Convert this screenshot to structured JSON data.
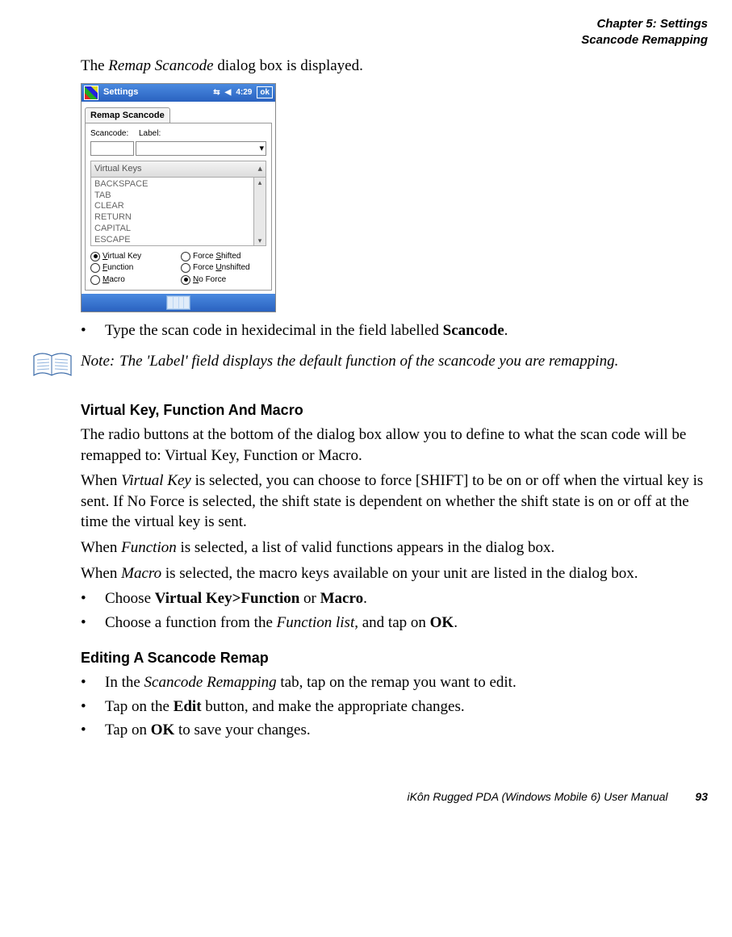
{
  "header": {
    "chapter": "Chapter 5:  Settings",
    "section": "Scancode Remapping"
  },
  "intro_pre": "The ",
  "intro_em": "Remap Scancode",
  "intro_post": " dialog box is displayed.",
  "screenshot": {
    "title": "Settings",
    "time": "4:29",
    "ok": "ok",
    "caption": "Remap Scancode",
    "scancode_lbl": "Scancode:",
    "label_lbl": "Label:",
    "dropdown_arrow": "▾",
    "list_header": "Virtual Keys",
    "list_header_arrow": "▴",
    "items": [
      "BACKSPACE",
      "TAB",
      "CLEAR",
      "RETURN",
      "CAPITAL",
      "ESCAPE"
    ],
    "scroll_up": "▴",
    "scroll_down": "▾",
    "radios": {
      "vkey": {
        "u": "V",
        "rest": "irtual Key",
        "checked": true
      },
      "fshift": {
        "u": "S",
        "pre": "Force ",
        "rest": "hifted",
        "checked": false
      },
      "func": {
        "u": "F",
        "rest": "unction",
        "checked": false
      },
      "funshift": {
        "u": "U",
        "pre": "Force ",
        "rest": "nshifted",
        "checked": false
      },
      "macro": {
        "u": "M",
        "rest": "acro",
        "checked": false
      },
      "noforce": {
        "u": "N",
        "rest": "o Force",
        "checked": true
      }
    }
  },
  "bullet1_pre": "Type the scan code in hexidecimal in the field labelled ",
  "bullet1_b": "Scancode",
  "bullet1_post": ".",
  "note": {
    "label": "Note:",
    "text": "The 'Label' field displays the default function of the scancode you are remapping."
  },
  "sub1": "Virtual Key, Function And Macro",
  "p1": "The radio buttons at the bottom of the dialog box allow you to define to what the scan code will be remapped to: Virtual Key, Function or Macro.",
  "p2": {
    "pre": "When ",
    "em": "Virtual Key",
    "post": " is selected, you can choose to force [SHIFT] to be on or off when the virtual key is sent. If No Force is selected, the shift state is dependent on whether the shift state is on or off at the time the virtual key is sent."
  },
  "p3": {
    "pre": "When ",
    "em": "Function",
    "post": " is selected, a list of valid functions appears in the dialog box."
  },
  "p4": {
    "pre": "When ",
    "em": "Macro",
    "post": " is selected, the macro keys available on your unit are listed in the dialog box."
  },
  "bullet2": {
    "pre": "Choose ",
    "b1": "Virtual Key>Function",
    "mid": " or ",
    "b2": "Macro",
    "post": "."
  },
  "bullet3": {
    "pre": "Choose a function from the ",
    "em": "Function list",
    "mid": ", and tap on ",
    "b": "OK",
    "post": "."
  },
  "sub2": "Editing A Scancode Remap",
  "bullet4": {
    "pre": "In the ",
    "em": "Scancode Remapping",
    "post": " tab, tap on the remap you want to edit."
  },
  "bullet5": {
    "pre": "Tap on the ",
    "b": "Edit",
    "post": " button, and make the appropriate changes."
  },
  "bullet6": {
    "pre": "Tap on ",
    "b": "OK",
    "post": " to save your changes."
  },
  "footer": {
    "text": "iKôn Rugged PDA (Windows Mobile 6) User Manual",
    "page": "93"
  }
}
